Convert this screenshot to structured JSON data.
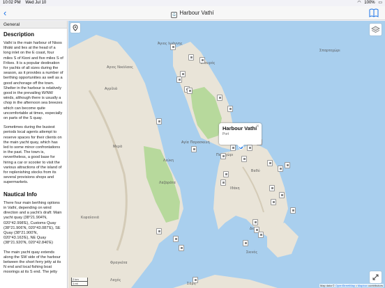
{
  "status": {
    "time": "10:02 PM",
    "date": "Wed Jul 10",
    "battery": "100%"
  },
  "nav": {
    "title": "Harbour Vathí"
  },
  "sidebar": {
    "tab": "General",
    "description_heading": "Description",
    "description_p1": "Vathí is the main harbour of Nisos Itháki and lies at the head of a long inlet on the E coast, four miles S of Kioni and five miles S of Frikes. It is a popular destination for yachts of all sizes during the season, as it provides a number of berthing opportunities as well as a good anchorage off the town. Shelter in the harbour is relatively good in the prevailing W/NW winds, although there is usually a chop in the afternoon sea breezes which can become quite uncomfortable at times, especially on parts of the S quay.",
    "description_p2": "Sometimes during the busiest periods local agents attempt to reserve spaces for their clients on the main yacht quay, which has led to some minor confrontations in the past. The town is, nevertheless, a good base for hiring a car or scooter to visit the various attractions of the island of for replenishing stocks from its several provisions shops and supermarkets.",
    "nautical_heading": "Nautical Info",
    "nautical_p1": "There four main berthing options in Vathí, depending on wind direction and a yacht's draft: Main yacht quay (38°21.904'N, 020°42.998'E), Customs Quay (38°21.906'N, 020°43.087'E), SE Quay (38°21.900'N, 020°43.163'E), NE Quay (38°21.920'N, 020°42.840'E)",
    "nautical_p2": "The main yacht quay extends along the SW side of the harbour between the short ferry jetty at its N end and local fishing boat moorings at its S end. The jetty"
  },
  "map": {
    "labels": [
      "Άγιος Ιωάννης",
      "Αγιος Νικόλαος",
      "Αγρίλιά",
      "Αγία Παρασκευή",
      "Περαχώρι",
      "Βαθύ",
      "Ιθάκη",
      "Λεύκη",
      "Λαζαράτα",
      "Κεφαλονιά",
      "Σάμη",
      "Μερά",
      "Σκινός",
      "Φραγκάτα",
      "Δεξιά",
      "Σταυρός",
      "Λαχός",
      "Σπαρτοχώρι"
    ],
    "callout_title": "Harbour Vathí",
    "callout_subtitle": "Port",
    "scale_km": "2 km",
    "scale_mi": "1 mi",
    "attribution_prefix": "Map data ©",
    "attribution_osm": "OpenStreetMap",
    "attribution_sep": " • ",
    "attribution_mapbox": "Mapbox",
    "attribution_suffix": "contributors",
    "colors": {
      "sea": "#a9cfee",
      "land": "#e9e4d8",
      "park": "#b7d99c",
      "accent": "#1a73e8"
    }
  }
}
